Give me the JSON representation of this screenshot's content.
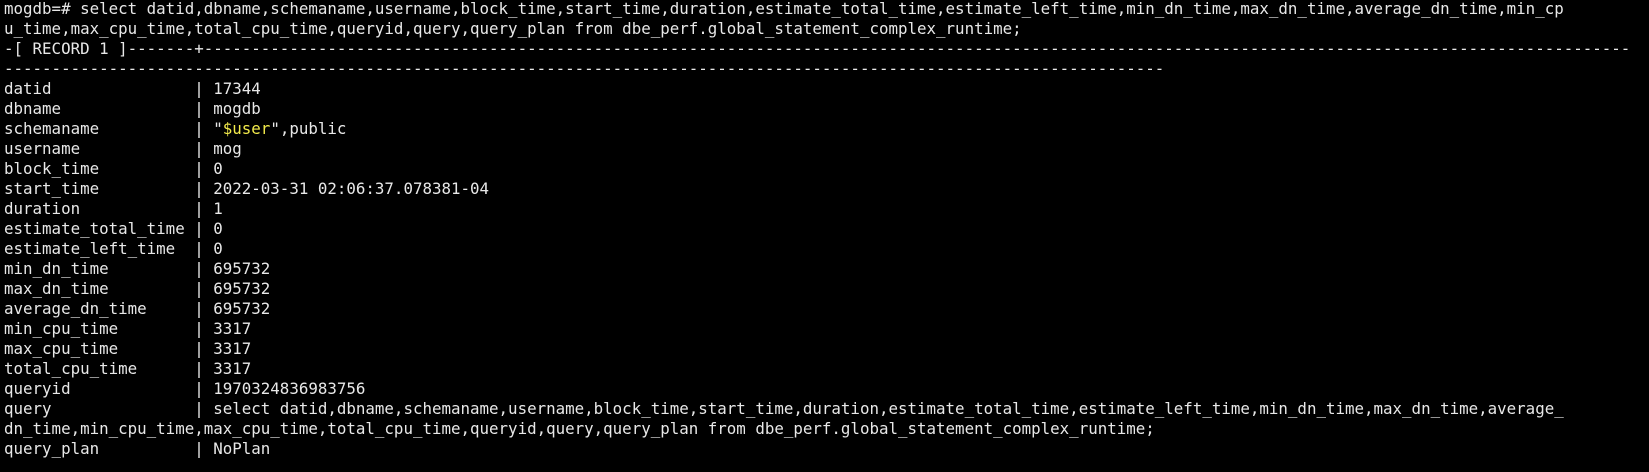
{
  "terminal": {
    "background": "#000000",
    "text_color": "#e8e8e8",
    "highlight_color": "#f2ea4b",
    "lines": [
      {
        "id": "cmd-1",
        "text": "mogdb=# select datid,dbname,schemaname,username,block_time,start_time,duration,estimate_total_time,estimate_left_time,min_dn_time,max_dn_time,average_dn_time,min_cp"
      },
      {
        "id": "cmd-2",
        "text": "u_time,max_cpu_time,total_cpu_time,queryid,query,query_plan from dbe_perf.global_statement_complex_runtime;"
      },
      {
        "id": "record-header-1",
        "text": "-[ RECORD 1 ]-------+------------------------------------------------------------------------------------------------------------------------------------------------------"
      },
      {
        "id": "record-header-2",
        "text": "--------------------------------------------------------------------------------------------------------------------------"
      },
      {
        "id": "row-datid",
        "text": "datid               | 17344"
      },
      {
        "id": "row-dbname",
        "text": "dbname              | mogdb"
      },
      {
        "id": "row-schemaname",
        "pre": "schemaname          | \"",
        "hl": "$user",
        "post": "\",public"
      },
      {
        "id": "row-username",
        "text": "username            | mog"
      },
      {
        "id": "row-block-time",
        "text": "block_time          | 0"
      },
      {
        "id": "row-start-time",
        "text": "start_time          | 2022-03-31 02:06:37.078381-04"
      },
      {
        "id": "row-duration",
        "text": "duration            | 1"
      },
      {
        "id": "row-estimate-total-time",
        "text": "estimate_total_time | 0"
      },
      {
        "id": "row-estimate-left-time",
        "text": "estimate_left_time  | 0"
      },
      {
        "id": "row-min-dn-time",
        "text": "min_dn_time         | 695732"
      },
      {
        "id": "row-max-dn-time",
        "text": "max_dn_time         | 695732"
      },
      {
        "id": "row-average-dn-time",
        "text": "average_dn_time     | 695732"
      },
      {
        "id": "row-min-cpu-time",
        "text": "min_cpu_time        | 3317"
      },
      {
        "id": "row-max-cpu-time",
        "text": "max_cpu_time        | 3317"
      },
      {
        "id": "row-total-cpu-time",
        "text": "total_cpu_time      | 3317"
      },
      {
        "id": "row-queryid",
        "text": "queryid             | 1970324836983756"
      },
      {
        "id": "row-query-1",
        "text": "query               | select datid,dbname,schemaname,username,block_time,start_time,duration,estimate_total_time,estimate_left_time,min_dn_time,max_dn_time,average_"
      },
      {
        "id": "row-query-2",
        "text": "dn_time,min_cpu_time,max_cpu_time,total_cpu_time,queryid,query,query_plan from dbe_perf.global_statement_complex_runtime;"
      },
      {
        "id": "row-query-plan",
        "text": "query_plan          | NoPlan"
      }
    ]
  }
}
